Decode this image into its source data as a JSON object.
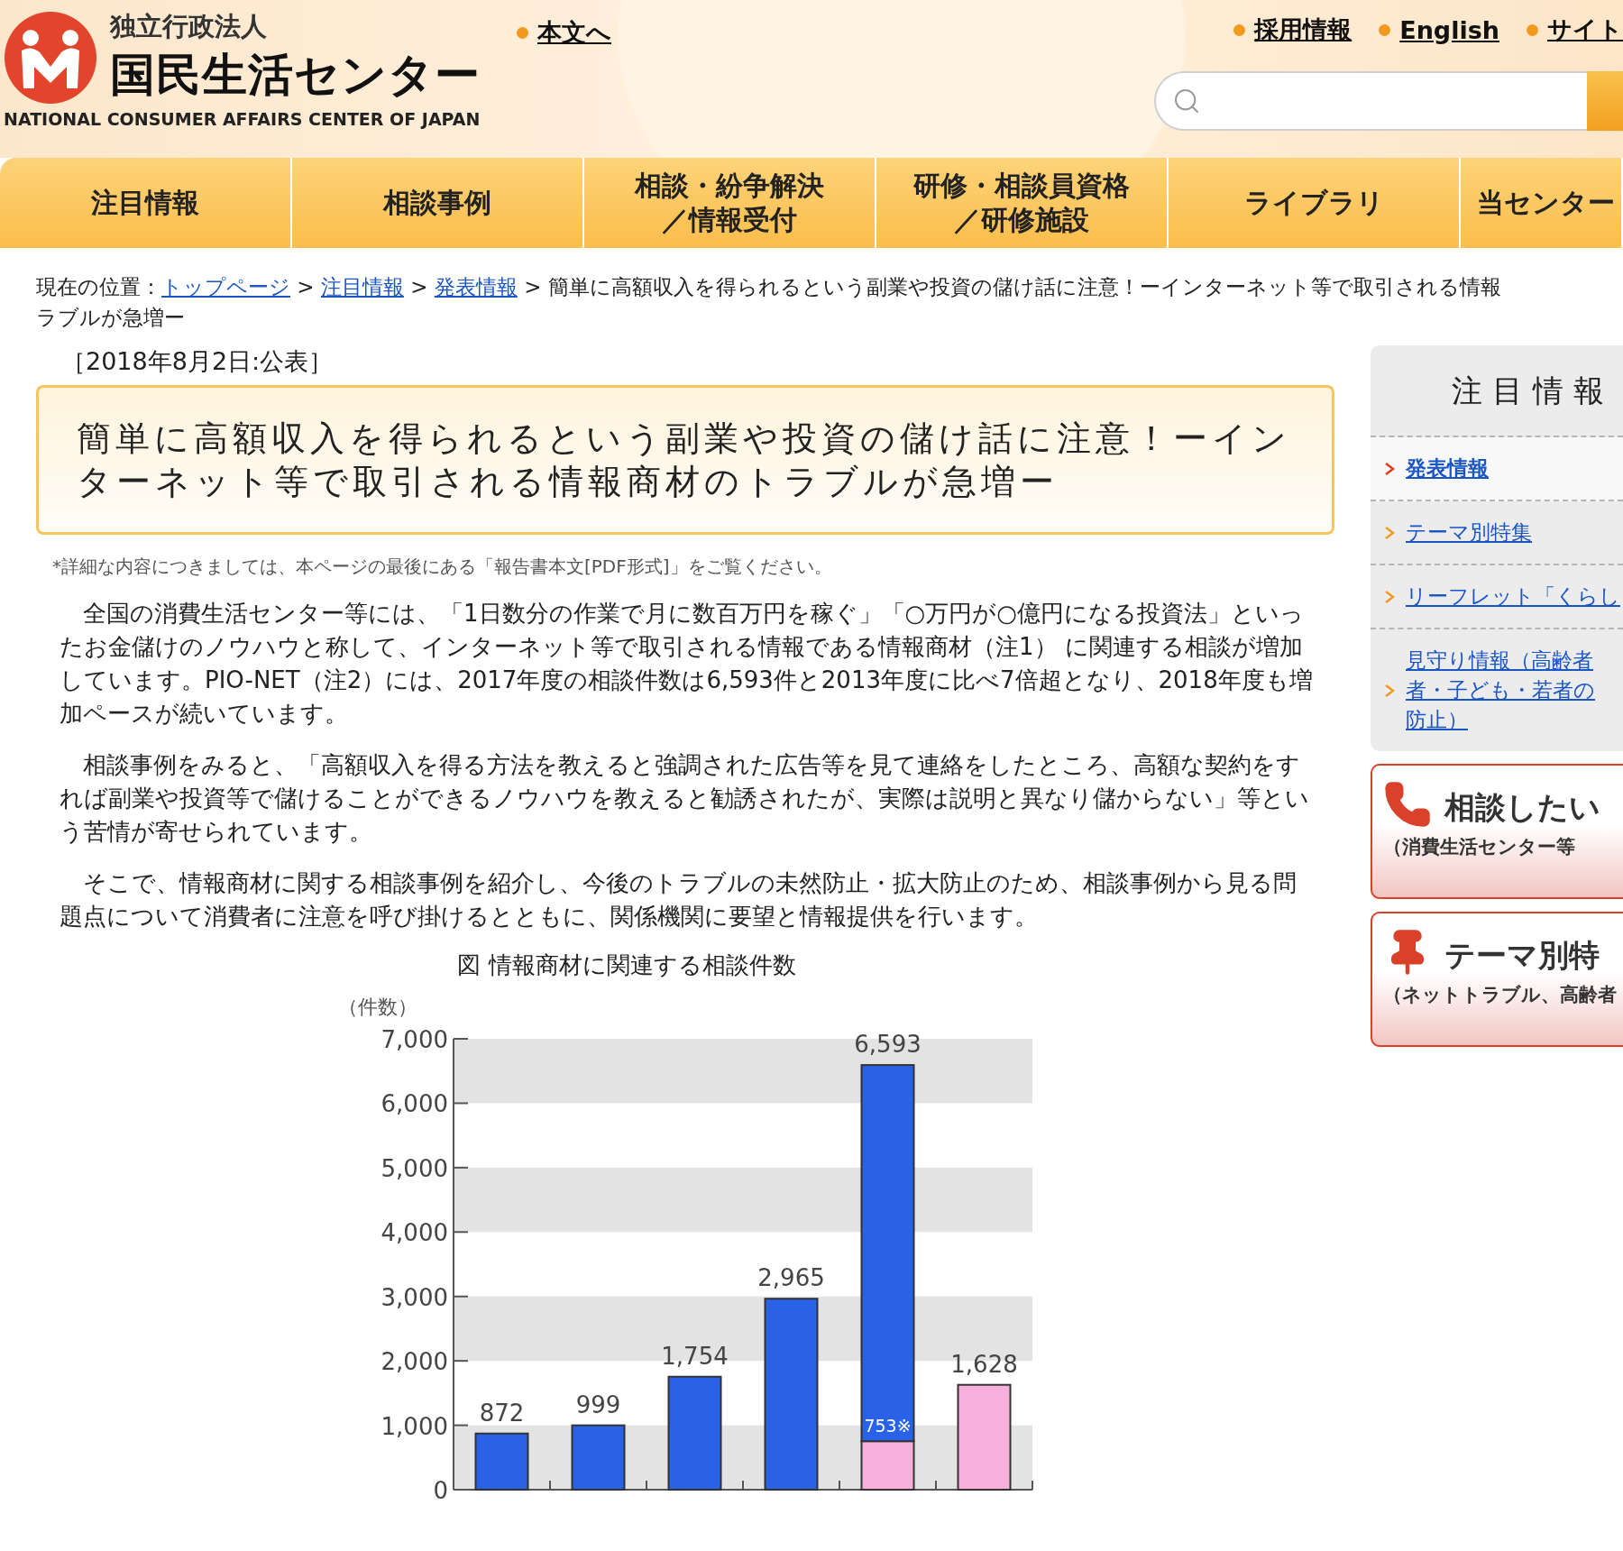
{
  "header": {
    "logo": {
      "subtitle": "独立行政法人",
      "title": "国民生活センター",
      "english": "NATIONAL CONSUMER AFFAIRS CENTER OF JAPAN"
    },
    "skip_link": "本文へ",
    "top_links": [
      "採用情報",
      "English",
      "サイト"
    ]
  },
  "nav": [
    {
      "lines": [
        "注目情報"
      ],
      "selected": false
    },
    {
      "lines": [
        "相談事例"
      ],
      "selected": false
    },
    {
      "lines": [
        "相談・紛争解決",
        "／情報受付"
      ],
      "selected": false
    },
    {
      "lines": [
        "研修・相談員資格",
        "／研修施設"
      ],
      "selected": false
    },
    {
      "lines": [
        "ライブラリ"
      ],
      "selected": false
    },
    {
      "lines": [
        "当センター"
      ],
      "selected": false
    }
  ],
  "breadcrumb": {
    "label": "現在の位置：",
    "links": [
      "トップページ",
      "注目情報",
      "発表情報"
    ],
    "separator": ">",
    "current_lines": [
      "簡単に高額収入を得られるという副業や投資の儲け話に注意！ーインターネット等で取引される情報",
      "ラブルが急増ー"
    ]
  },
  "article": {
    "date": "［2018年8月2日:公表］",
    "title": "簡単に高額収入を得られるという副業や投資の儲け話に注意！ーインターネット等で取引される情報商材のトラブルが急増ー",
    "note": "*詳細な内容につきましては、本ページの最後にある「報告書本文[PDF形式]」をご覧ください。",
    "paragraphs": [
      "全国の消費生活センター等には、「1日数分の作業で月に数百万円を稼ぐ」「○万円が○億円になる投資法」といったお金儲けのノウハウと称して、インターネット等で取引される情報である情報商材（注1） に関連する相談が増加しています。PIO-NET（注2）には、2017年度の相談件数は6,593件と2013年度に比べ7倍超となり、2018年度も増加ペースが続いています。",
      "相談事例をみると、「高額収入を得る方法を教えると強調された広告等を見て連絡をしたところ、高額な契約をすれば副業や投資等で儲けることができるノウハウを教えると勧誘されたが、実際は説明と異なり儲からない」等という苦情が寄せられています。",
      "そこで、情報商材に関する相談事例を紹介し、今後のトラブルの未然防止・拡大防止のため、相談事例から見る問題点について消費者に注意を呼び掛けるとともに、関係機関に要望と情報提供を行います。"
    ],
    "chart_data": {
      "type": "bar",
      "title": "図 情報商材に関連する相談件数",
      "ylabel": "（件数）",
      "stacked": true,
      "orientation": "vertical",
      "ylim": [
        0,
        7000
      ],
      "yticks": [
        {
          "value": 0,
          "label": "0"
        },
        {
          "value": 1000,
          "label": "1,000"
        },
        {
          "value": 2000,
          "label": "2,000"
        },
        {
          "value": 3000,
          "label": "3,000"
        },
        {
          "value": 4000,
          "label": "4,000"
        },
        {
          "value": 5000,
          "label": "5,000"
        },
        {
          "value": 6000,
          "label": "6,000"
        },
        {
          "value": 7000,
          "label": "7,000"
        }
      ],
      "series": [
        {
          "color": "#2962e6",
          "values": [
            872,
            999,
            1754,
            2965,
            5840,
            null
          ]
        },
        {
          "color": "#f7b0dc",
          "values": [
            null,
            null,
            null,
            null,
            753,
            1628
          ]
        }
      ],
      "value_labels": [
        "872",
        "999",
        "1,754",
        "2,965",
        "6,593",
        "1,628"
      ],
      "annotations": [
        {
          "text": "753※"
        }
      ]
    }
  },
  "sidebar": {
    "heading": "注目情報",
    "items": [
      {
        "lines": [
          "発表情報"
        ],
        "selected": true
      },
      {
        "lines": [
          "テーマ別特集"
        ],
        "selected": false
      },
      {
        "lines": [
          "リーフレット「くらし"
        ],
        "selected": false
      },
      {
        "lines": [
          "見守り情報（高齢者",
          "者・子ども・若者の",
          "防止）"
        ],
        "selected": false
      }
    ],
    "cards": [
      {
        "kind": "phone",
        "title": "相談したい",
        "subtitle": "（消費生活センター等"
      },
      {
        "kind": "pin",
        "title": "テーマ別特",
        "subtitle": "（ネットトラブル、高齢者"
      }
    ]
  }
}
